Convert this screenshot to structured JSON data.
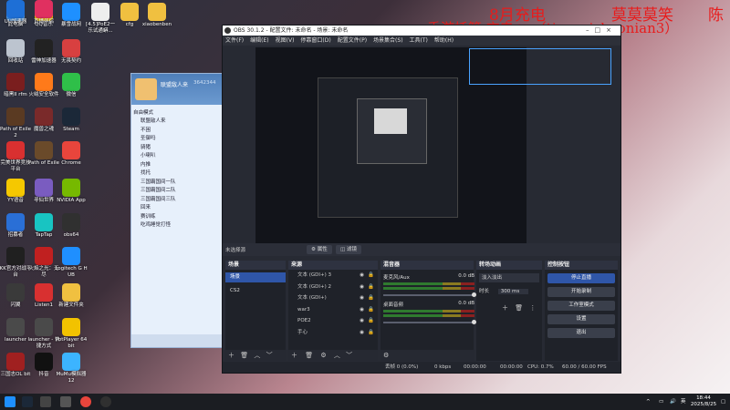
{
  "desktop_icons": [
    {
      "label": "此电脑",
      "color": "#4a90d9"
    },
    {
      "label": "QQ音乐",
      "color": "#f2c200"
    },
    {
      "label": "暴雪战网",
      "color": "#1e90ff"
    },
    {
      "label": "[4.5]PoE2一乐试通蟒...",
      "color": "#eeeeee"
    },
    {
      "label": "cfg",
      "color": "#f0c040"
    },
    {
      "label": "xiaobenben",
      "color": "#f0c040"
    },
    {
      "label": "回收站",
      "color": "#bcc4cf"
    },
    {
      "label": "雷神加速器",
      "color": "#222222"
    },
    {
      "label": "无畏契约",
      "color": "#d84040"
    },
    {
      "label": "暗黑II rfm",
      "color": "#7a1e1e"
    },
    {
      "label": "火绒安全软件",
      "color": "#ff7a1a"
    },
    {
      "label": "微信",
      "color": "#2fbf49"
    },
    {
      "label": "Path of Exile 2",
      "color": "#5a3a22"
    },
    {
      "label": "魔兽之魂",
      "color": "#7a2a2a"
    },
    {
      "label": "Steam",
      "color": "#1b2838"
    },
    {
      "label": "完美世界竞技平台",
      "color": "#d93030"
    },
    {
      "label": "Path of Exile",
      "color": "#6a4a2a"
    },
    {
      "label": "Chrome",
      "color": "#e8453c"
    },
    {
      "label": "YY语音",
      "color": "#f5c800"
    },
    {
      "label": "寻仙世界",
      "color": "#7a5cc0"
    },
    {
      "label": "NVIDIA App",
      "color": "#76b900"
    },
    {
      "label": "招募者",
      "color": "#2a6fd6"
    },
    {
      "label": "TapTap",
      "color": "#18c4c2"
    },
    {
      "label": "obs64",
      "color": "#303030"
    },
    {
      "label": "KK官方对战平台",
      "color": "#202020"
    },
    {
      "label": "火焰之光：无尽",
      "color": "#c02020"
    },
    {
      "label": "Logitech G HUB",
      "color": "#1f8fff"
    },
    {
      "label": "闪翼",
      "color": "#3a3a3a"
    },
    {
      "label": "Listen1",
      "color": "#d83030"
    },
    {
      "label": "新建文件夹",
      "color": "#f0c040"
    },
    {
      "label": "launcher",
      "color": "#4a4a4a"
    },
    {
      "label": "launcher - 快捷方式",
      "color": "#4a4a4a"
    },
    {
      "label": "PotPlayer 64 bit",
      "color": "#f2c200"
    },
    {
      "label": "三国志OL bit",
      "color": "#a02020"
    },
    {
      "label": "抖音",
      "color": "#111111"
    },
    {
      "label": "MuMu模拟器12",
      "color": "#3cb4ff"
    },
    {
      "label": "UU加速器",
      "color": "#1e6fd6"
    },
    {
      "label": "直播伴侣",
      "color": "#e03060"
    }
  ],
  "overlay": {
    "line1a": "8月充电",
    "line1b": "莫莫莫笑",
    "line1c": "陈",
    "line2": "手游托管 充电+v（tiancaishaonian3）"
  },
  "chat": {
    "name": "联盟敌人来",
    "number": "3642344",
    "mode": "自由模式",
    "rows": [
      "联盟敌人来",
      "不困",
      "圣御吗",
      "骑猪",
      "小喇叭",
      "内推",
      "找托",
      "三国霸国间一队",
      "三国霸国间二队",
      "三国霸国间三队",
      "回来",
      "赛训练",
      "吃鸡睡觉打怪"
    ]
  },
  "obs": {
    "title": "OBS 30.1.2 - 配置文件: 未命名 - 场景: 未命名",
    "menu": [
      "文件(F)",
      "编辑(E)",
      "视图(V)",
      "停靠窗口(D)",
      "配置文件(P)",
      "场景集合(S)",
      "工具(T)",
      "帮助(H)"
    ],
    "no_source": "未选择源",
    "btn_properties": "属性",
    "btn_filters": "滤镜",
    "docks": {
      "scenes": "场景",
      "sources": "来源",
      "mixer": "混音器",
      "transitions": "转场动画",
      "controls": "控制按钮"
    },
    "scenes": [
      "场景",
      "CS2"
    ],
    "sources": [
      "文本 (GDI+) 3",
      "文本 (GDI+) 2",
      "文本 (GDI+)",
      "war3",
      "POE2",
      "手心"
    ],
    "mixer": [
      {
        "name": "麦克风/Aux",
        "db": "0.0 dB"
      },
      {
        "name": "桌面音频",
        "db": "0.0 dB"
      }
    ],
    "transition": {
      "type": "淡入淡出",
      "duration_label": "时长",
      "duration": "300 ms"
    },
    "controls": [
      "停止直播",
      "开始录制",
      "工作室模式",
      "设置",
      "退出"
    ],
    "status": {
      "frames": "丢帧 0 (0.0%)",
      "bitrate": "0 kbps",
      "stream_time": "00:00:00",
      "rec_time": "00:00:00",
      "cpu": "CPU: 0.7%",
      "fps": "60.00 / 60.00 FPS"
    }
  },
  "taskbar": {
    "lang": "英",
    "time": "18:44",
    "date": "2025/8/25"
  }
}
